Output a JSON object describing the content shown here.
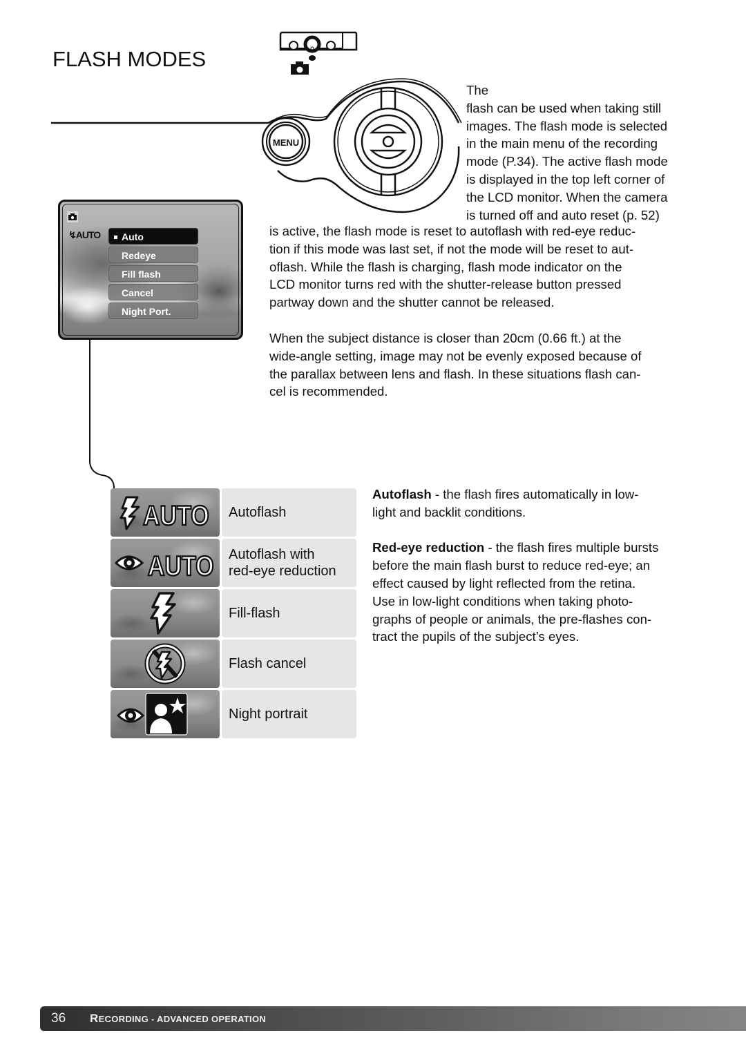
{
  "header": {
    "title": "FLASH MODES",
    "icons": [
      "camera-top-diagram-icon",
      "recording-mode-camera-icon"
    ]
  },
  "diagram": {
    "menu_button_label": "MENU",
    "controller": "four-way-controller"
  },
  "intro": {
    "lines_top": [
      "The",
      "flash can be used when taking still",
      "images. The flash mode is selected",
      "in the main menu of the recording",
      "mode (P.34). The active flash mode",
      "is displayed in the top left corner of",
      "the LCD monitor. When the camera",
      "is turned off and auto reset (p. 52)"
    ],
    "continuation": "is active, the flash mode is reset to autoflash with red-eye reduc-tion if this mode was last set, if not the mode will be reset to aut-oflash. While the flash is charging, flash mode indicator on the LCD monitor turns red with the shutter-release button pressed partway down and the shutter cannot be released.",
    "continuation_lines": [
      "is active, the flash mode is reset to autoflash with red-eye reduc-",
      "tion if this mode was last set, if not the mode will be reset to aut-",
      "oflash. While the flash is charging, flash mode indicator on the",
      "LCD monitor turns red with the shutter-release button pressed",
      "partway down and the shutter cannot be released."
    ]
  },
  "note": {
    "lines": [
      "When the subject distance is closer than 20cm (0.66 ft.) at the",
      "wide-angle setting, image may not be evenly exposed  because of",
      "the parallax between lens and flash. In these situations flash can-",
      "cel is recommended."
    ]
  },
  "lcd": {
    "mode_icon": "camera-icon",
    "flash_indicator": "AUTO",
    "menu_items": [
      {
        "label": "Auto",
        "selected": true
      },
      {
        "label": "Redeye",
        "selected": false
      },
      {
        "label": "Fill flash",
        "selected": false
      },
      {
        "label": "Cancel",
        "selected": false
      },
      {
        "label": "Night Port.",
        "selected": false
      }
    ]
  },
  "modes": [
    {
      "icon": "autoflash-icon",
      "icon_text": "AUTO",
      "label_lines": [
        "Autoflash"
      ]
    },
    {
      "icon": "red-eye-auto-icon",
      "icon_text": "AUTO",
      "label_lines": [
        "Autoflash with",
        "red-eye reduction"
      ]
    },
    {
      "icon": "fill-flash-icon",
      "icon_text": "",
      "label_lines": [
        "Fill-flash"
      ]
    },
    {
      "icon": "flash-cancel-icon",
      "icon_text": "",
      "label_lines": [
        "Flash cancel"
      ]
    },
    {
      "icon": "night-portrait-icon",
      "icon_text": "",
      "label_lines": [
        "Night portrait"
      ]
    }
  ],
  "descriptions": [
    {
      "term": "Autoflash",
      "lines": [
        " - the flash fires automatically in low-",
        "light and backlit conditions."
      ]
    },
    {
      "term": "Red-eye reduction",
      "lines": [
        " - the flash fires multiple bursts",
        "before the main flash burst to reduce red-eye; an",
        "effect caused by light reflected from the retina.",
        "Use in low-light conditions when taking photo-",
        "graphs of people or animals, the pre-flashes con-",
        "tract the pupils of the subject’s eyes."
      ]
    }
  ],
  "footer": {
    "page_number": "36",
    "section_first_letter": "R",
    "section_rest": "ECORDING - ADVANCED OPERATION"
  }
}
